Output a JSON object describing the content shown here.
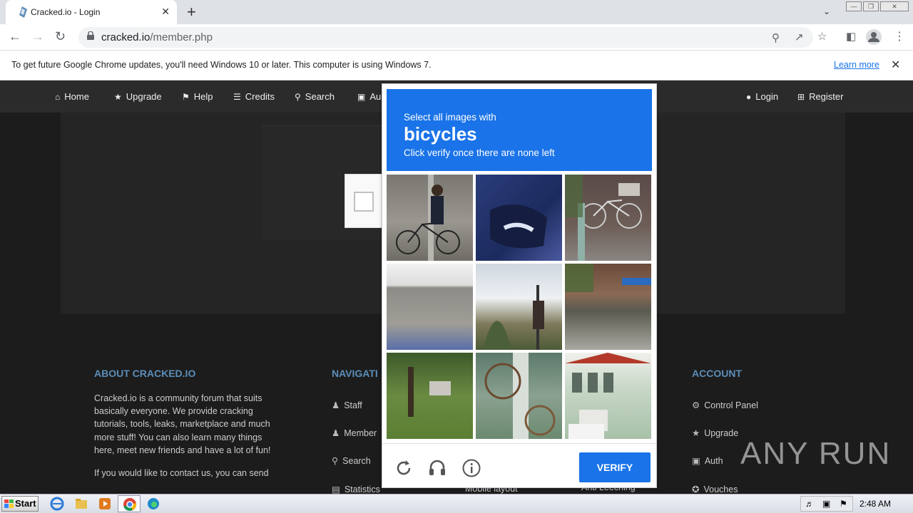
{
  "browser": {
    "tab_title": "Cracked.io - Login",
    "url_host": "cracked.io",
    "url_path": "/member.php",
    "new_tab": "+",
    "tab_close": "✕"
  },
  "infobar": {
    "message": "To get future Google Chrome updates, you'll need Windows 10 or later. This computer is using Windows 7.",
    "learn_more": "Learn more"
  },
  "site_nav": {
    "items": [
      {
        "label": "Home",
        "icon": "home-icon"
      },
      {
        "label": "Upgrade",
        "icon": "star-icon"
      },
      {
        "label": "Help",
        "icon": "flag-icon"
      },
      {
        "label": "Credits",
        "icon": "coins-icon"
      },
      {
        "label": "Search",
        "icon": "search-icon"
      },
      {
        "label": "Au",
        "icon": "lock-icon"
      }
    ],
    "right": [
      {
        "label": "Login",
        "icon": "user-icon"
      },
      {
        "label": "Register",
        "icon": "plus-square-icon"
      }
    ]
  },
  "footer": {
    "about_title": "ABOUT CRACKED.IO",
    "about_text": "Cracked.io is a community forum that suits basically everyone. We provide cracking tutorials, tools, leaks, marketplace and much more stuff! You can also learn many things here, meet new friends and have a lot of fun!",
    "about_text2": "If you would like to contact us, you can send",
    "nav_title": "NAVIGATI",
    "nav_links": [
      "Staff",
      "Member",
      "Search",
      "Statistics"
    ],
    "mid_links": [
      "Mobile layout",
      "Anti Leeching"
    ],
    "account_title": "ACCOUNT",
    "account_links": [
      "Control Panel",
      "Upgrade",
      "Auth",
      "Vouches"
    ]
  },
  "captcha": {
    "line1": "Select all images with",
    "target": "bicycles",
    "line3": "Click verify once there are none left",
    "verify": "VERIFY"
  },
  "watermark": "ANY RUN",
  "taskbar": {
    "start": "Start",
    "clock": "2:48 AM"
  },
  "colors": {
    "accent": "#1a73e8",
    "footer_heading": "#5b8db8"
  }
}
